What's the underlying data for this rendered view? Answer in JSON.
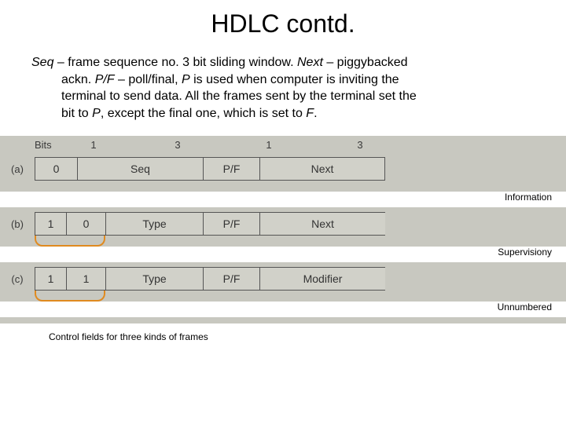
{
  "title": "HDLC contd.",
  "paragraph": {
    "seq_label": "Seq",
    "line1_rest": " – frame sequence no. 3 bit sliding window. ",
    "next_label": "Next",
    "line1_tail": " – piggybacked",
    "line2a": "ackn. ",
    "pf_label": "P/F",
    "line2b": " – poll/final, ",
    "p_label": "P",
    "line2c": " is used when computer is inviting the",
    "line3": "terminal to send data. All the frames sent by the terminal set the",
    "line4a": "bit to ",
    "line4b": ", except the final one, which is set to ",
    "f_label": "F",
    "line4c": "."
  },
  "bits": {
    "label": "Bits",
    "c1": "1",
    "c2": "3",
    "c3": "1",
    "c4": "3"
  },
  "rows": {
    "a": {
      "label": "(a)",
      "f1": "0",
      "f2": "Seq",
      "f3": "P/F",
      "f4": "Next",
      "side": "Information"
    },
    "b": {
      "label": "(b)",
      "f1": "1",
      "f1b": "0",
      "f2": "Type",
      "f3": "P/F",
      "f4": "Next",
      "side": "Supervisiony"
    },
    "c": {
      "label": "(c)",
      "f1": "1",
      "f1b": "1",
      "f2": "Type",
      "f3": "P/F",
      "f4": "Modifier",
      "side": "Unnumbered"
    }
  },
  "caption": "Control fields for three kinds of frames"
}
